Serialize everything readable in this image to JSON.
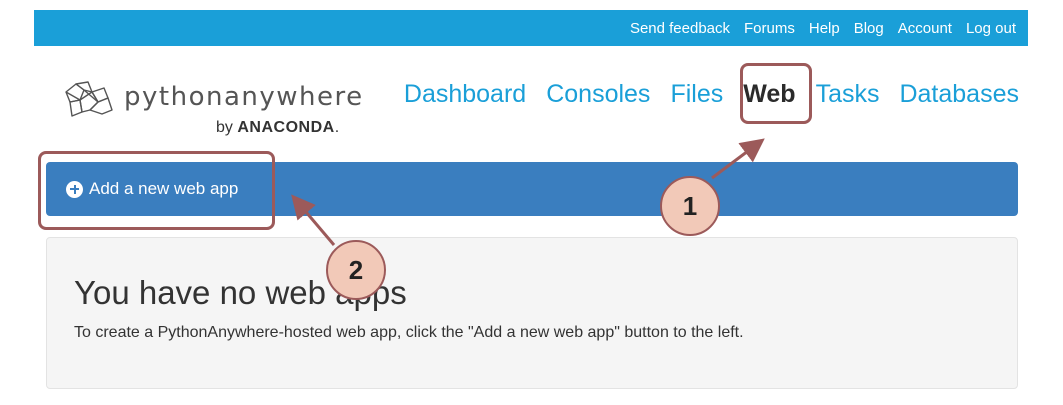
{
  "topbar": {
    "links": [
      "Send feedback",
      "Forums",
      "Help",
      "Blog",
      "Account",
      "Log out"
    ]
  },
  "logo": {
    "text": "pythonanywhere",
    "by": "by",
    "brand": "ANACONDA",
    "brand_suffix": "."
  },
  "nav": {
    "items": [
      "Dashboard",
      "Consoles",
      "Files",
      "Web",
      "Tasks",
      "Databases"
    ],
    "active": "Web"
  },
  "actionbar": {
    "add_label": "Add a new web app"
  },
  "panel": {
    "title": "You have no web apps",
    "text": "To create a PythonAnywhere-hosted web app, click the \"Add a new web app\" button to the left."
  },
  "callouts": [
    "1",
    "2"
  ],
  "colors": {
    "topbar": "#1a9fd8",
    "nav_link": "#1a9fd8",
    "actionbar": "#3a7ebf",
    "callout_border": "#9c5a5a",
    "callout_fill": "#f2c9b8"
  }
}
